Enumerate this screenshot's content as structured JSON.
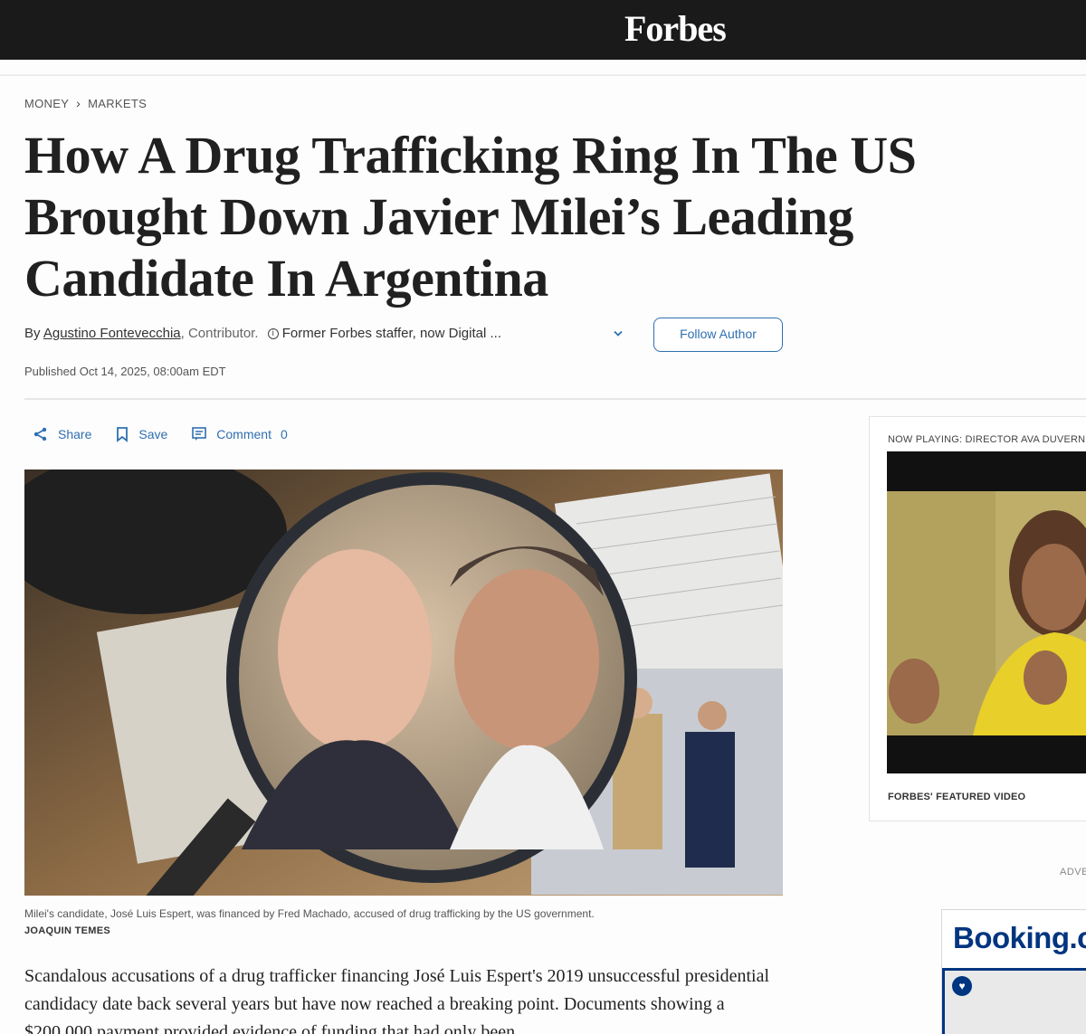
{
  "header": {
    "logo": "Forbes"
  },
  "breadcrumb": {
    "items": [
      "MONEY",
      "MARKETS"
    ]
  },
  "article": {
    "headline": "How A Drug Trafficking Ring In The US Brought Down Javier Milei’s Leading Candidate In Argentina",
    "byline": {
      "by": "By",
      "author": "Agustino Fontevecchia",
      "role": ", Contributor.",
      "bio": "Former Forbes staffer, now Digital ...",
      "follow_label": "Follow Author"
    },
    "published": "Published Oct 14, 2025, 08:00am EDT",
    "actions": {
      "share": "Share",
      "save": "Save",
      "comment": "Comment",
      "comment_count": "0"
    },
    "image": {
      "caption": "Milei's candidate, José Luis Espert, was financed by Fred Machado, accused of drug trafficking by the US government.",
      "credit": "JOAQUIN TEMES"
    },
    "body": "Scandalous accusations of a drug trafficker financing José Luis Espert's 2019 unsuccessful presidential candidacy date back several years but have now reached a breaking point. Documents showing a $200,000 payment provided evidence of funding that had only been"
  },
  "sidebar": {
    "video": {
      "now_playing": "NOW PLAYING: DIRECTOR AVA DUVERN",
      "featured": "FORBES' FEATURED VIDEO"
    },
    "ad": {
      "label": "ADVE",
      "brand": "Booking.co"
    }
  },
  "colors": {
    "accent": "#2f6fb0",
    "topbar": "#1a1a1a",
    "booking": "#003580"
  }
}
